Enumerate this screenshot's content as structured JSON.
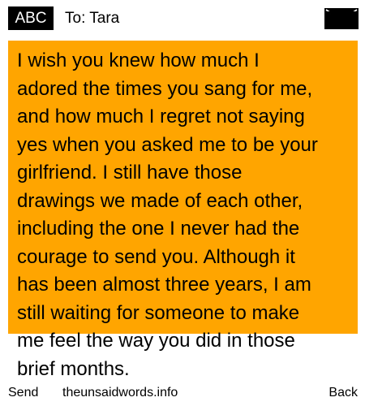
{
  "header": {
    "mode_label": "ABC",
    "to_label": "To: Tara",
    "envelope_icon": "envelope-icon"
  },
  "message": {
    "text": "I wish you knew how much I\nadored the times you sang for me,\nand how much I regret not saying\nyes when you asked me to be your\ngirlfriend. I still have those\ndrawings we made of each other,\nincluding the one I never had the\ncourage to send you. Although it\nhas been almost three years, I am\nstill waiting for someone to make\nme feel the way you did in those\nbrief months."
  },
  "softkeys": {
    "left_label": "Send",
    "center_label": "theunsaidwords.info",
    "right_label": "Back"
  },
  "colors": {
    "message_background": "#ffa500",
    "header_badge_background": "#000000",
    "text": "#000000",
    "page_background": "#ffffff"
  }
}
